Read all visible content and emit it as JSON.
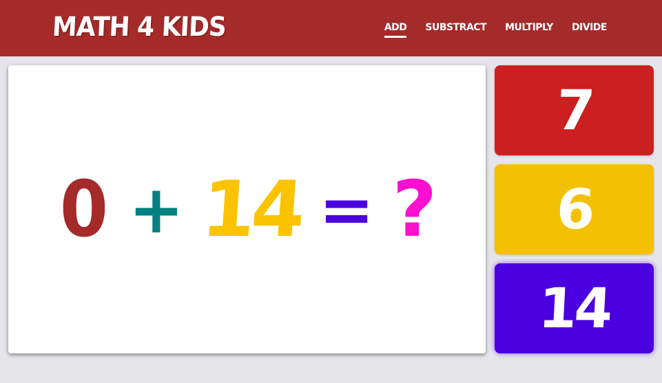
{
  "header": {
    "logo": "MATH 4 KIDS",
    "nav": [
      {
        "label": "ADD",
        "active": true
      },
      {
        "label": "SUBSTRACT",
        "active": false
      },
      {
        "label": "MULTIPLY",
        "active": false
      },
      {
        "label": "DIVIDE",
        "active": false
      }
    ]
  },
  "question": {
    "operand1": "0",
    "operator": "+",
    "operand2": "14",
    "equals": "=",
    "unknown": "?"
  },
  "answers": [
    {
      "label": "7",
      "color": "#cc1f1f"
    },
    {
      "label": "6",
      "color": "#f3c102"
    },
    {
      "label": "14",
      "color": "#4b00e0"
    }
  ],
  "colors": {
    "header_bg": "#a52a2a",
    "operand1": "#a52a2a",
    "operator": "#008080",
    "operand2": "#fbc300",
    "equals": "#4b00e0",
    "unknown": "#ff10d0",
    "page_bg": "#e6e5ea"
  }
}
